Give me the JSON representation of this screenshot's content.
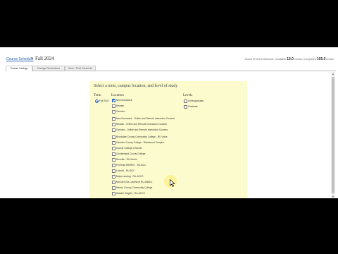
{
  "breadcrumb": {
    "link": "Course Schedule",
    "separator": "»",
    "term": "Fall 2024"
  },
  "stats": {
    "prefix": "Sound Of Sell & Schedule / Available",
    "available_value": "13.0",
    "available_unit": "credits",
    "completed_prefix": "Completed",
    "completed_value": "105.0",
    "completed_unit": "credits"
  },
  "tabs": [
    {
      "label": "Course Listings"
    },
    {
      "label": "Change Restrictions"
    },
    {
      "label": "Save / Print Schedule"
    }
  ],
  "panel": {
    "title": "Select a term, campus location, and level of study",
    "term_heading": "Term",
    "location_heading": "Location",
    "level_heading": "Levels",
    "terms": [
      {
        "label": "Fall 2024",
        "checked": true
      }
    ],
    "locations": [
      {
        "label": "New Brunswick",
        "checked": true
      },
      {
        "label": "Newark",
        "checked": false
      },
      {
        "label": "Camden",
        "checked": false
      },
      {
        "label": "New Brunswick - Online and Remote Instruction Courses",
        "checked": false
      },
      {
        "label": "Newark - Online and Remote Instruction Courses",
        "checked": false
      },
      {
        "label": "Camden - Online and Remote Instruction Courses",
        "checked": false
      },
      {
        "label": "Brookdale County Community College - RU Voice",
        "checked": false
      },
      {
        "label": "Camden County College - Blackwood Campus",
        "checked": false
      },
      {
        "label": "County College of Morris",
        "checked": false
      },
      {
        "label": "Cumberland County College",
        "checked": false
      },
      {
        "label": "Denville - RU Morris",
        "checked": false
      },
      {
        "label": "Freehold WMHEC - RU-BCC",
        "checked": false
      },
      {
        "label": "Lincroft - RU-BCC",
        "checked": false
      },
      {
        "label": "Mays Landing - RU-ACCC",
        "checked": false
      },
      {
        "label": "McGuire-Dix-Lakehurst RU-JBMDL",
        "checked": false
      },
      {
        "label": "Mercer County Community College",
        "checked": false
      },
      {
        "label": "Atlantic Heights - RU-ACCC",
        "checked": false
      }
    ],
    "levels": [
      {
        "label": "Undergraduate",
        "checked": false
      },
      {
        "label": "Graduate",
        "checked": false
      }
    ]
  },
  "colors": {
    "panel_background": "#fbfbcd",
    "checkbox_checked": "#2d6cc4",
    "link": "#2a61b3"
  }
}
